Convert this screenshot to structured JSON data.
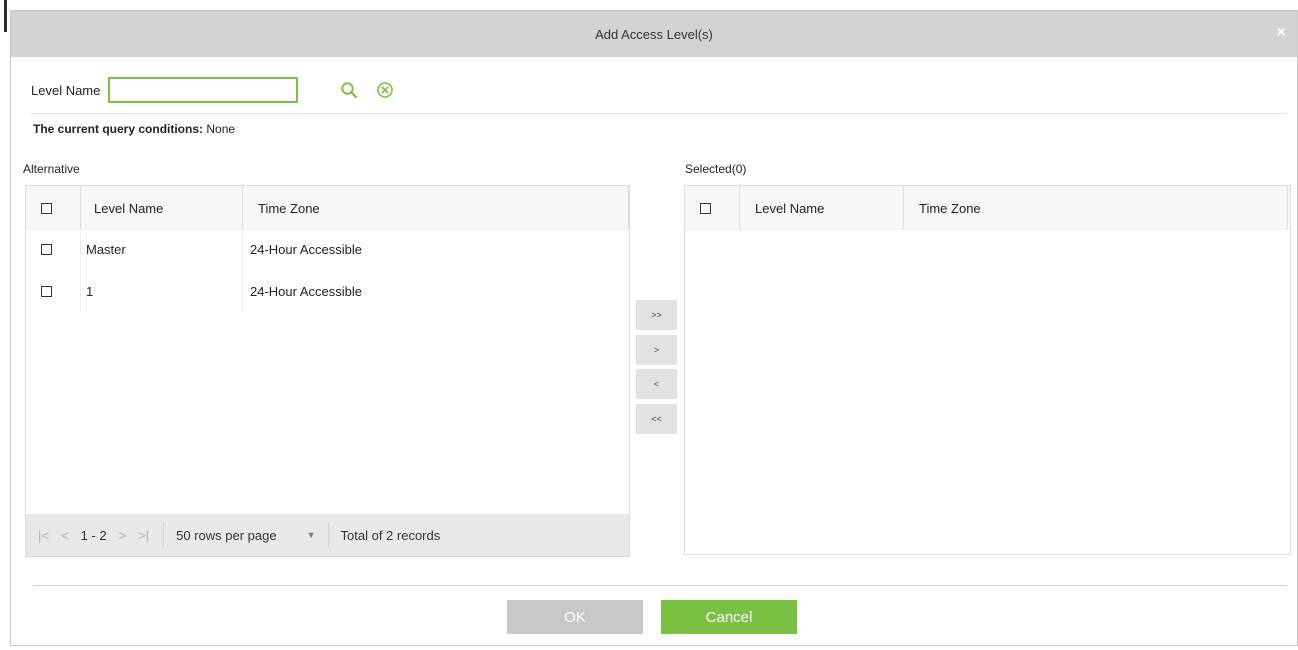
{
  "dialog": {
    "title": "Add Access Level(s)",
    "close_glyph": "×"
  },
  "search": {
    "label": "Level Name",
    "value": "",
    "search_icon": "search-icon",
    "clear_icon": "clear-circle-icon"
  },
  "query": {
    "label": "The current query conditions:",
    "value": "None"
  },
  "alternative": {
    "title": "Alternative",
    "columns": [
      "Level Name",
      "Time Zone"
    ],
    "rows": [
      {
        "level_name": "Master",
        "time_zone": "24-Hour Accessible"
      },
      {
        "level_name": "1",
        "time_zone": "24-Hour Accessible"
      }
    ],
    "pager": {
      "first": "|<",
      "prev": "<",
      "range": "1 - 2",
      "next": ">",
      "last": ">|",
      "rows_per_page": "50 rows per page",
      "total": "Total of 2 records"
    }
  },
  "selected": {
    "title": "Selected(0)",
    "columns": [
      "Level Name",
      "Time Zone"
    ],
    "rows": []
  },
  "move_buttons": {
    "add_all": ">>",
    "add": ">",
    "remove": "<",
    "remove_all": "<<"
  },
  "footer": {
    "ok_label": "OK",
    "cancel_label": "Cancel"
  },
  "colors": {
    "accent_green": "#7ac143",
    "titlebar_bg": "#d3d3d3",
    "disabled_button": "#c8c8c8"
  }
}
